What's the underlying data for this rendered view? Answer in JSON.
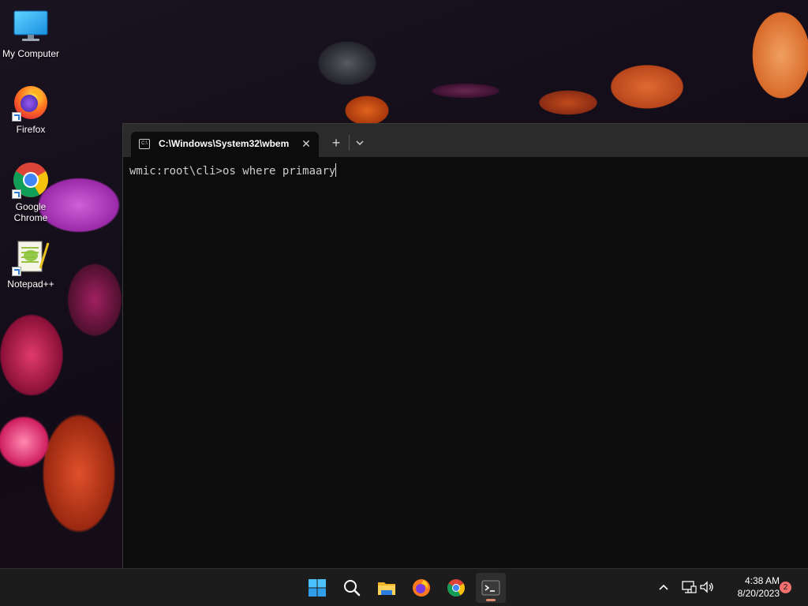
{
  "desktop": {
    "icons": [
      {
        "label": "My Computer",
        "icon": "monitor-icon"
      },
      {
        "label": "Firefox",
        "icon": "firefox-icon"
      },
      {
        "label": "Google Chrome",
        "icon": "chrome-icon"
      },
      {
        "label": "Notepad++",
        "icon": "notepad-plus-plus-icon"
      }
    ]
  },
  "terminal": {
    "tab": {
      "title": "C:\\Windows\\System32\\wbem",
      "icon": "cmd-icon",
      "icon_text": "C:\\"
    },
    "console": {
      "prompt": "wmic:root\\cli>",
      "input": "os where primaary"
    }
  },
  "taskbar": {
    "items": [
      "windows-start-icon",
      "search-icon",
      "file-explorer-icon",
      "firefox-icon",
      "chrome-icon",
      "terminal-icon"
    ],
    "active_item": "terminal-icon",
    "tray": {
      "icons": [
        "chevron-up-icon",
        "network-icon",
        "volume-icon"
      ]
    },
    "clock": {
      "time": "4:38 AM",
      "date": "8/20/2023"
    },
    "notification_count": "2"
  },
  "colors": {
    "terminal_bg": "#0c0c0c",
    "tabbar_bg": "#2b2b2b",
    "taskbar_bg": "#1c1c1c",
    "badge": "#f07070"
  }
}
